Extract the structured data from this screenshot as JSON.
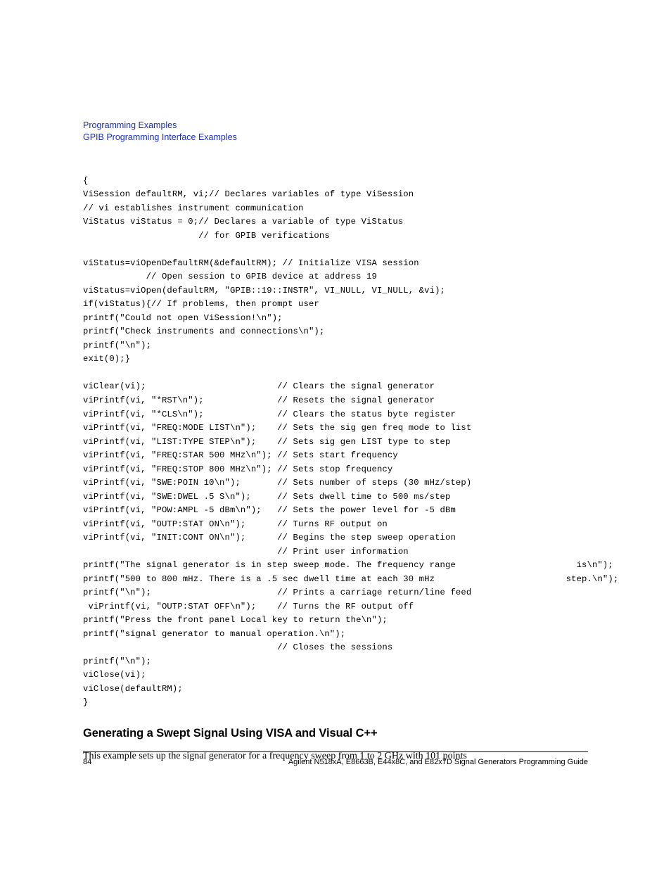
{
  "header": {
    "line1": "Programming Examples",
    "line2": "GPIB Programming Interface Examples"
  },
  "code": "{\nViSession defaultRM, vi;// Declares variables of type ViSession\n// vi establishes instrument communication\nViStatus viStatus = 0;// Declares a variable of type ViStatus\n                      // for GPIB verifications\n\nviStatus=viOpenDefaultRM(&defaultRM); // Initialize VISA session\n            // Open session to GPIB device at address 19\nviStatus=viOpen(defaultRM, \"GPIB::19::INSTR\", VI_NULL, VI_NULL, &vi);\nif(viStatus){// If problems, then prompt user\nprintf(\"Could not open ViSession!\\n\");\nprintf(\"Check instruments and connections\\n\");\nprintf(\"\\n\");\nexit(0);}\n\nviClear(vi);                         // Clears the signal generator\nviPrintf(vi, \"*RST\\n\");              // Resets the signal generator\nviPrintf(vi, \"*CLS\\n\");              // Clears the status byte register\nviPrintf(vi, \"FREQ:MODE LIST\\n\");    // Sets the sig gen freq mode to list\nviPrintf(vi, \"LIST:TYPE STEP\\n\");    // Sets sig gen LIST type to step\nviPrintf(vi, \"FREQ:STAR 500 MHz\\n\"); // Sets start frequency\nviPrintf(vi, \"FREQ:STOP 800 MHz\\n\"); // Sets stop frequency\nviPrintf(vi, \"SWE:POIN 10\\n\");       // Sets number of steps (30 mHz/step)\nviPrintf(vi, \"SWE:DWEL .5 S\\n\");     // Sets dwell time to 500 ms/step\nviPrintf(vi, \"POW:AMPL -5 dBm\\n\");   // Sets the power level for -5 dBm\nviPrintf(vi, \"OUTP:STAT ON\\n\");      // Turns RF output on\nviPrintf(vi, \"INIT:CONT ON\\n\");      // Begins the step sweep operation\n                                     // Print user information \nprintf(\"The signal generator is in step sweep mode. The frequency range                       is\\n\");\nprintf(\"500 to 800 mHz. There is a .5 sec dwell time at each 30 mHz                         step.\\n\");\nprintf(\"\\n\");                        // Prints a carriage return/line feed\n viPrintf(vi, \"OUTP:STAT OFF\\n\");    // Turns the RF output off\nprintf(\"Press the front panel Local key to return the\\n\");\nprintf(\"signal generator to manual operation.\\n\");\n                                     // Closes the sessions\nprintf(\"\\n\");\nviClose(vi);\nviClose(defaultRM);\n}",
  "section": {
    "heading": "Generating a Swept Signal Using VISA and Visual C++",
    "paragraph": "This example sets up the signal generator for a frequency sweep from 1 to 2 GHz with 101 points"
  },
  "footer": {
    "page_number": "84",
    "guide_title": "Agilent N518xA, E8663B, E44x8C, and E82x7D Signal Generators Programming Guide"
  }
}
